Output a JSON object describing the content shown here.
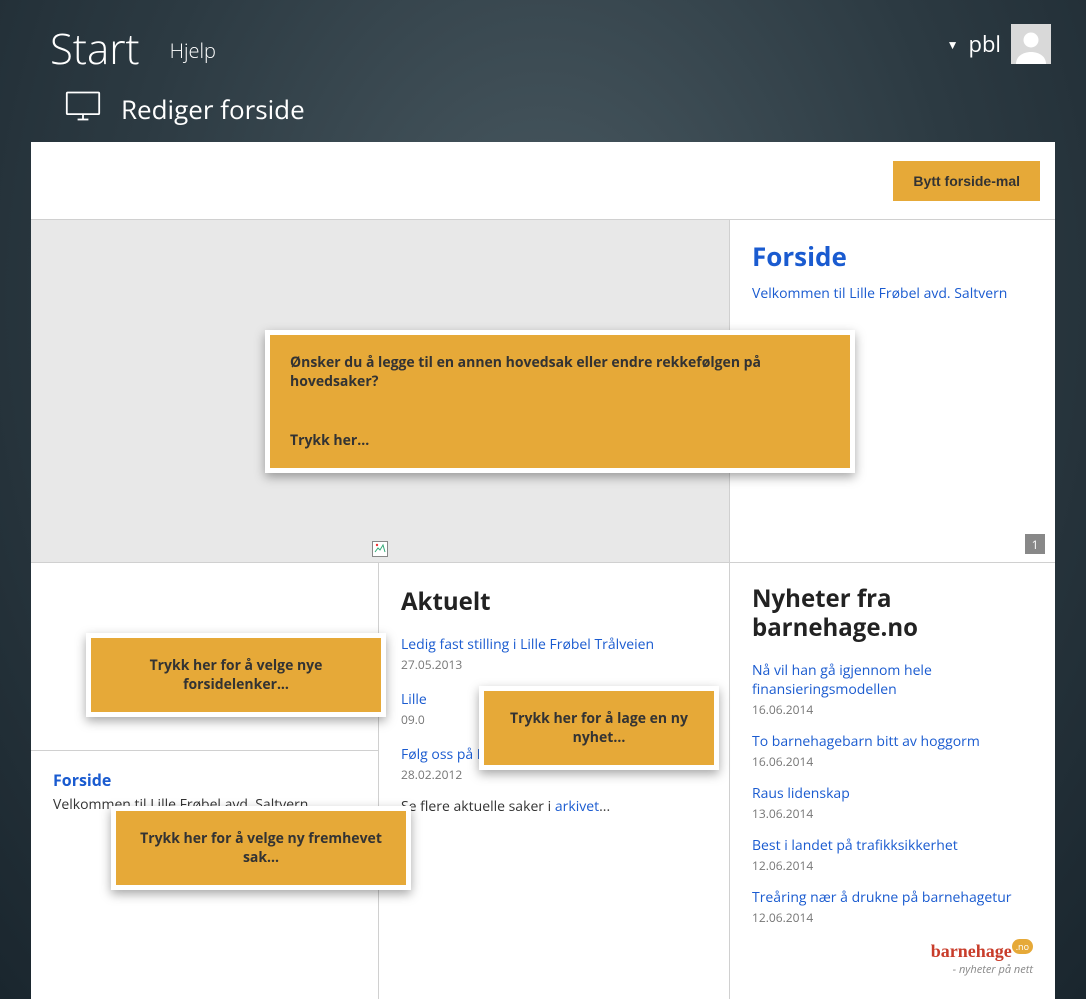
{
  "topbar": {
    "start": "Start",
    "help": "Hjelp",
    "username": "pbl"
  },
  "page_title": "Rediger forside",
  "switch_template_btn": "Bytt forside-mal",
  "hero": {
    "side_title": "Forside",
    "side_welcome": "Velkommen til Lille Frøbel avd. Saltvern",
    "pager": "1"
  },
  "callout_big": {
    "line1": "Ønsker du å legge til en annen hovedsak eller endre rekkefølgen på hovedsaker?",
    "line2": "Trykk her..."
  },
  "callout_links": "Trykk her for å velge nye forsidelenker...",
  "featured": {
    "title": "Forside",
    "welcome": "Velkommen til Lille Frøbel avd. Saltvern"
  },
  "callout_featured": "Trykk her for å velge ny fremhevet sak...",
  "aktuelt": {
    "heading": "Aktuelt",
    "items": [
      {
        "title": "Ledig fast stilling i Lille Frøbel Trålveien",
        "date": "27.05.2013"
      },
      {
        "title": "Lille",
        "date": "09.0"
      },
      {
        "title": "Følg oss på Facebook",
        "date": "28.02.2012"
      }
    ],
    "archive_prefix": "Se flere aktuelle saker i ",
    "archive_link": "arkivet",
    "archive_suffix": "..."
  },
  "callout_newnews": "Trykk her for å lage en ny nyhet...",
  "nyheter": {
    "heading": "Nyheter fra barnehage.no",
    "items": [
      {
        "title": "Nå vil han gå igjennom hele finansieringsmodellen",
        "date": "16.06.2014"
      },
      {
        "title": "To barnehagebarn bitt av hoggorm",
        "date": "16.06.2014"
      },
      {
        "title": "Raus lidenskap",
        "date": "13.06.2014"
      },
      {
        "title": "Best i landet på trafikksikkerhet",
        "date": "12.06.2014"
      },
      {
        "title": "Treåring nær å drukne på barnehagetur",
        "date": "12.06.2014"
      }
    ],
    "logo_brand": "barnehage",
    "logo_dot": ".no",
    "logo_tag": "- nyheter på nett"
  }
}
